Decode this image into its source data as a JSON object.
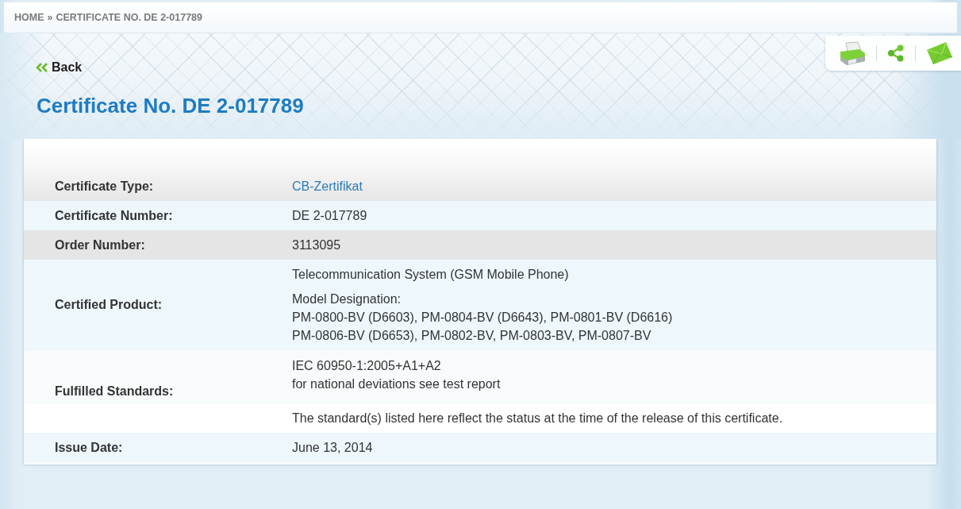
{
  "breadcrumb": {
    "items": [
      "HOME",
      "CERTIFICATE NO. DE 2-017789"
    ],
    "separator": "»"
  },
  "back_link": "Back",
  "title": "Certificate No. DE 2-017789",
  "details": {
    "rows": [
      {
        "label": "Certificate Type:",
        "kind": "link",
        "highlighted": false,
        "paragraphs": [
          [
            "CB-Zertifikat"
          ]
        ]
      },
      {
        "label": "Certificate Number:",
        "kind": "text",
        "highlighted": false,
        "paragraphs": [
          [
            "DE 2-017789"
          ]
        ]
      },
      {
        "label": "Order Number:",
        "kind": "text",
        "highlighted": true,
        "paragraphs": [
          [
            "3113095"
          ]
        ]
      },
      {
        "label": "Certified Product:",
        "kind": "text",
        "highlighted": false,
        "paragraphs": [
          [
            "Telecommunication System (GSM Mobile Phone)"
          ],
          [
            "Model Designation:",
            "PM-0800-BV (D6603), PM-0804-BV (D6643), PM-0801-BV (D6616)",
            "PM-0806-BV (D6653), PM-0802-BV, PM-0803-BV, PM-0807-BV"
          ]
        ]
      },
      {
        "label": "Fulfilled Standards:",
        "kind": "text",
        "highlighted": false,
        "paragraphs": [
          [
            "IEC 60950-1:2005+A1+A2",
            "for national deviations see test report"
          ]
        ],
        "note": "The standard(s) listed here reflect the status at the time of the release of this certificate."
      },
      {
        "label": "Issue Date:",
        "kind": "text",
        "highlighted": false,
        "paragraphs": [
          [
            "June 13, 2014"
          ]
        ]
      }
    ]
  }
}
